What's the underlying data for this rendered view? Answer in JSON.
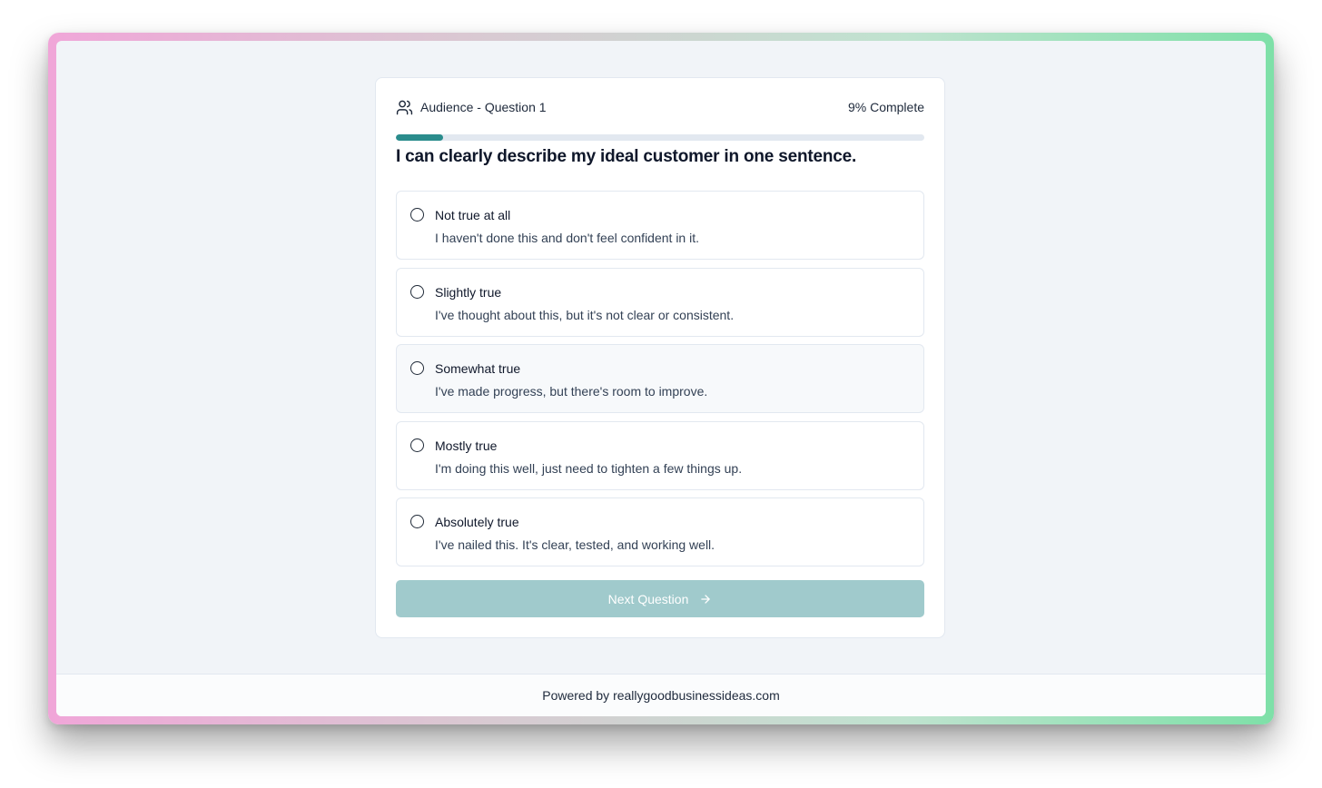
{
  "header": {
    "section_label": "Audience - Question 1",
    "progress_text": "9% Complete",
    "progress_percent": 9
  },
  "question": "I can clearly describe my ideal customer in one sentence.",
  "options": [
    {
      "label": "Not true at all",
      "description": "I haven't done this and don't feel confident in it."
    },
    {
      "label": "Slightly true",
      "description": "I've thought about this, but it's not clear or consistent."
    },
    {
      "label": "Somewhat true",
      "description": "I've made progress, but there's room to improve."
    },
    {
      "label": "Mostly true",
      "description": "I'm doing this well, just need to tighten a few things up."
    },
    {
      "label": "Absolutely true",
      "description": "I've nailed this. It's clear, tested, and working well."
    }
  ],
  "next_button": {
    "label": "Next Question",
    "icon": "arrow-right-icon",
    "disabled": true
  },
  "footer": {
    "text": "Powered by reallygoodbusinessideas.com"
  },
  "icons": {
    "section": "users-icon"
  },
  "colors": {
    "accent": "#2a8c8c",
    "button_disabled": "#a0cacc",
    "frame_left": "#f0a6d8",
    "frame_right": "#7ee0a8"
  }
}
